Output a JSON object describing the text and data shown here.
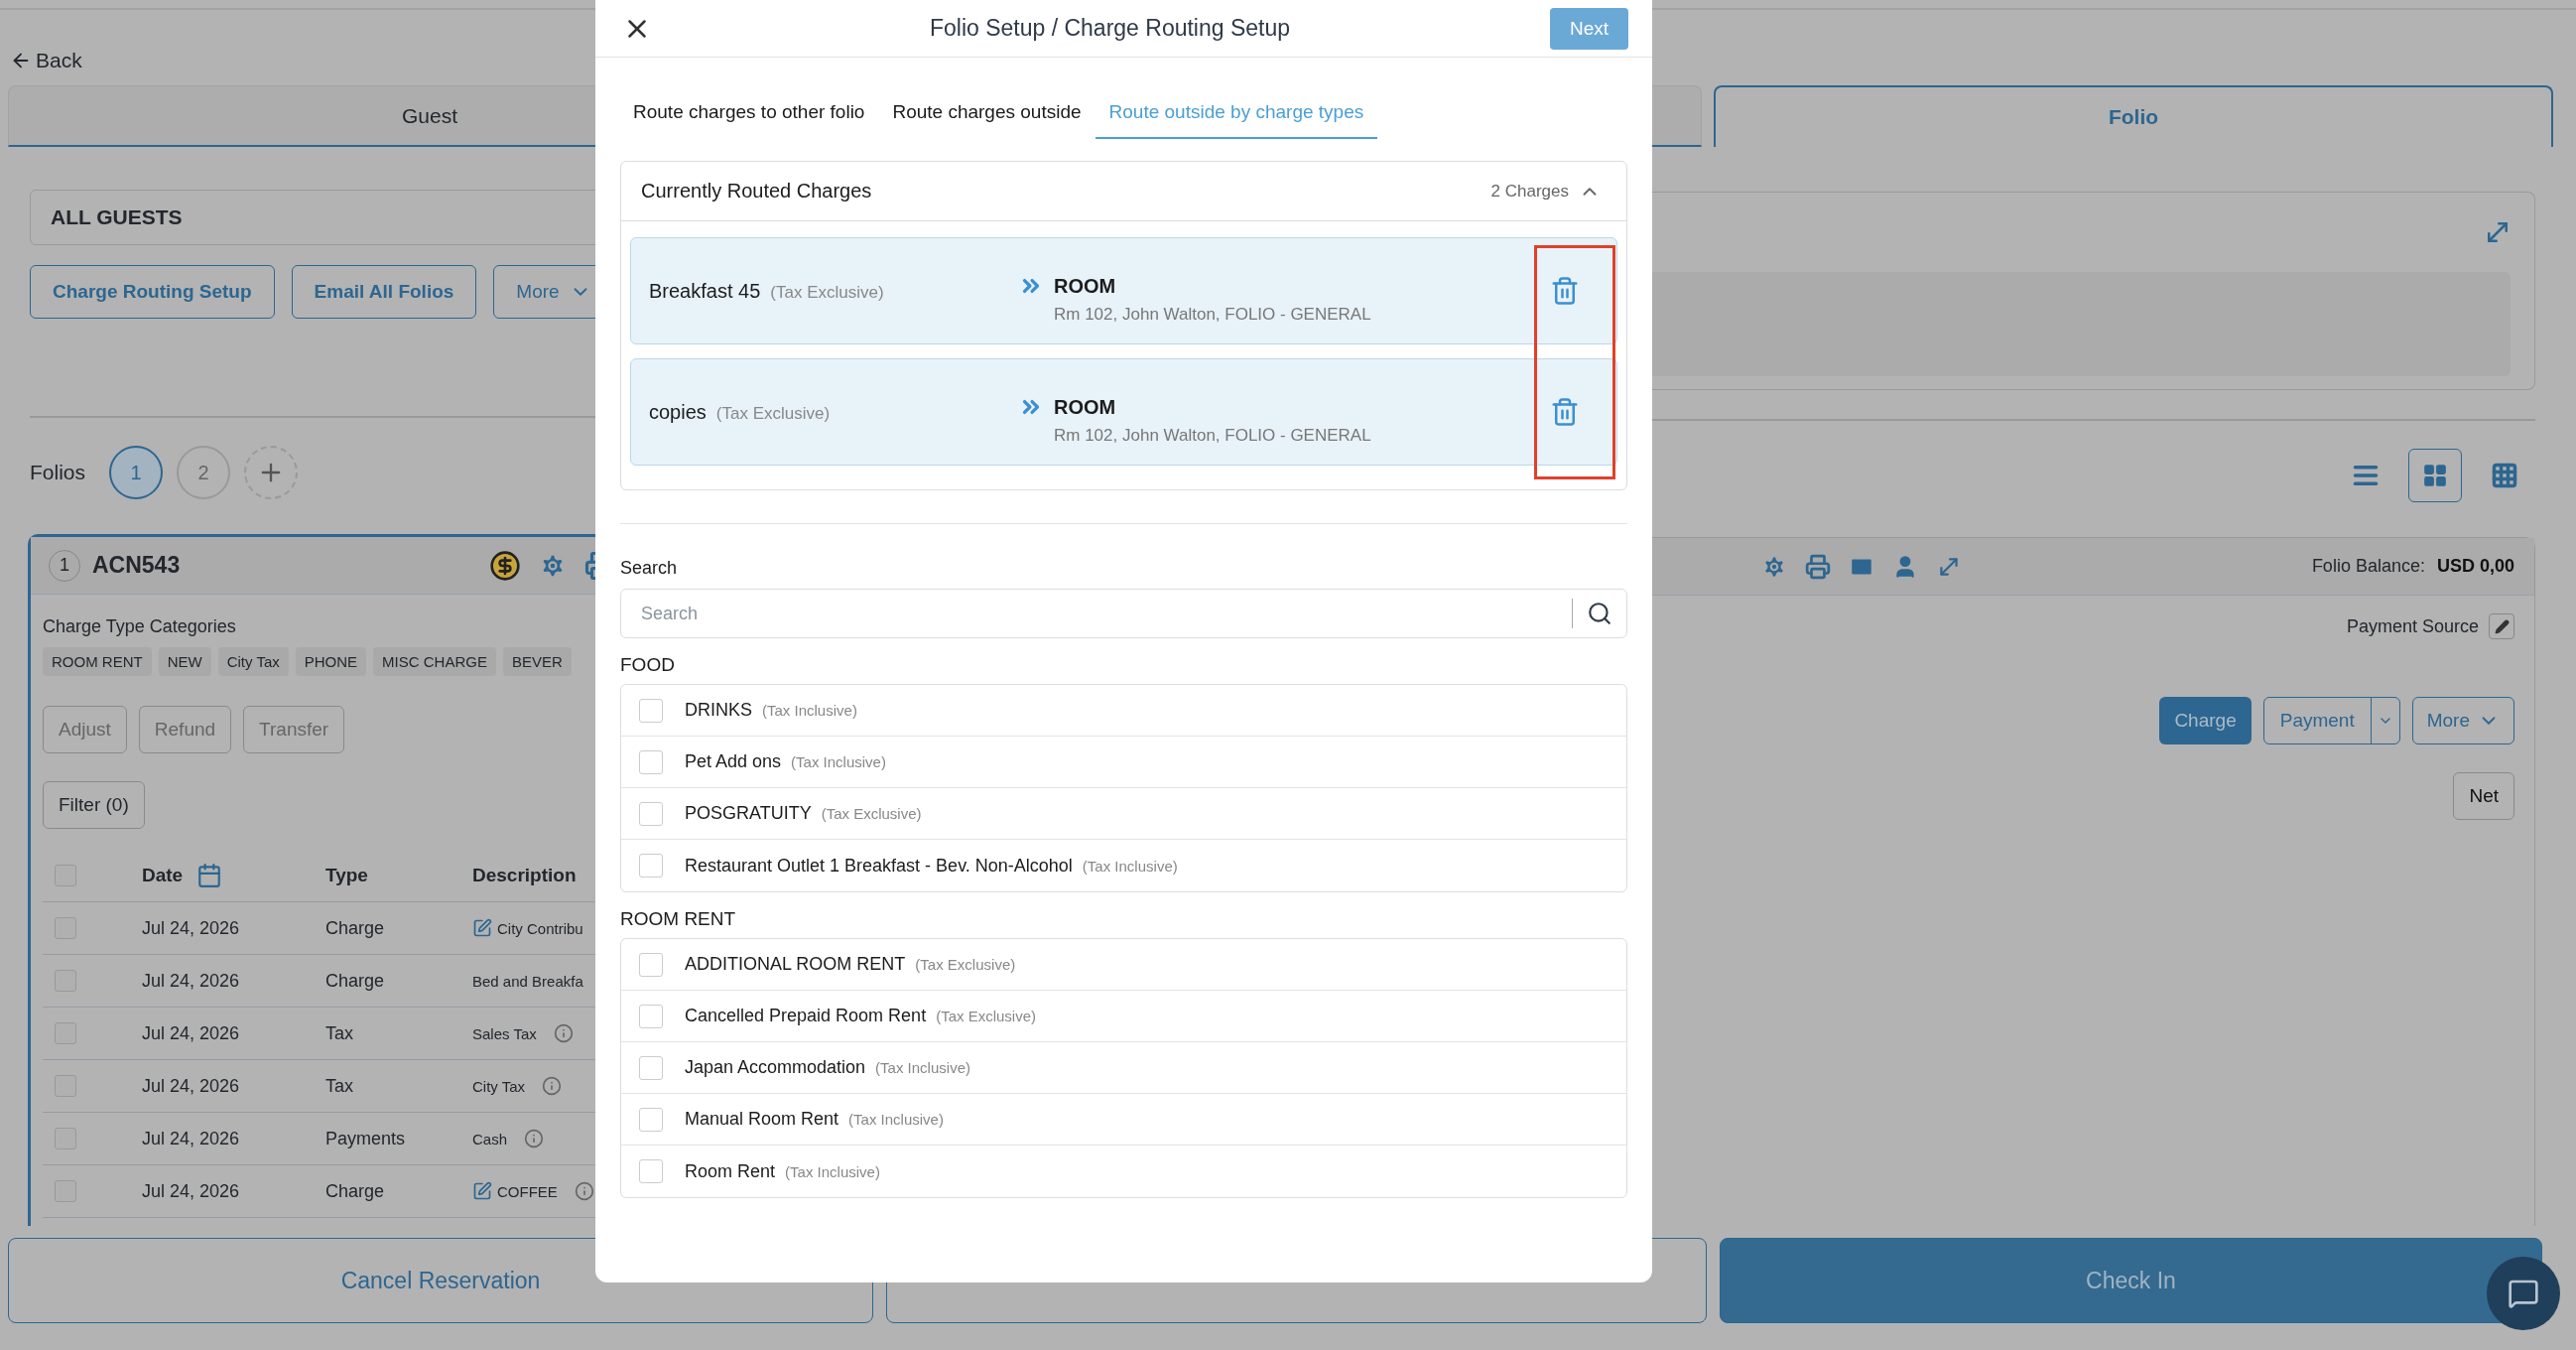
{
  "back": "Back",
  "page_tabs": [
    {
      "label": "Guest",
      "selected": false
    },
    {
      "label": "Folio",
      "selected": true
    }
  ],
  "guests_panel": {
    "title": "ALL GUESTS",
    "buttons": [
      "Charge Routing Setup",
      "Email All Folios"
    ],
    "more": "More"
  },
  "folios": {
    "label": "Folios",
    "items": [
      {
        "label": "1",
        "selected": true
      },
      {
        "label": "2",
        "selected": false
      }
    ]
  },
  "view_modes": [
    {
      "kind": "list",
      "selected": false
    },
    {
      "kind": "grid",
      "selected": true
    },
    {
      "kind": "tiles",
      "selected": false
    }
  ],
  "folio_card": {
    "number": "1",
    "name": "ACN543",
    "balance_label": "Folio Balance:",
    "balance": "USD 0,00",
    "categories_label": "Charge Type Categories",
    "categories": [
      "ROOM RENT",
      "NEW",
      "City Tax",
      "PHONE",
      "MISC CHARGE",
      "BEVER"
    ],
    "payment_source": "Payment Source",
    "left_actions": [
      "Adjust",
      "Refund",
      "Transfer"
    ],
    "charge": "Charge",
    "payment": "Payment",
    "more": "More",
    "filter": "Filter (0)",
    "net": "Net",
    "select_all": {
      "checked": false
    },
    "columns": [
      "Date",
      "Type",
      "Description"
    ],
    "rows": [
      {
        "checked": false,
        "date": "Jul 24, 2026",
        "type": "Charge",
        "description": "City Contribu",
        "edit_icon": true,
        "info_icon": false
      },
      {
        "checked": false,
        "date": "Jul 24, 2026",
        "type": "Charge",
        "description": "Bed and Breakfa",
        "edit_icon": false,
        "info_icon": false
      },
      {
        "checked": false,
        "date": "Jul 24, 2026",
        "type": "Tax",
        "description": "Sales Tax",
        "edit_icon": false,
        "info_icon": true
      },
      {
        "checked": false,
        "date": "Jul 24, 2026",
        "type": "Tax",
        "description": "City Tax",
        "edit_icon": false,
        "info_icon": true
      },
      {
        "checked": false,
        "date": "Jul 24, 2026",
        "type": "Payments",
        "description": "Cash",
        "edit_icon": false,
        "info_icon": true
      },
      {
        "checked": false,
        "date": "Jul 24, 2026",
        "type": "Charge",
        "description": "COFFEE",
        "edit_icon": true,
        "info_icon": true
      }
    ]
  },
  "footer": {
    "cancel": "Cancel Reservation",
    "check_in": "Check In"
  },
  "modal": {
    "title": "Folio Setup / Charge Routing Setup",
    "next": "Next",
    "tabs": [
      {
        "label": "Route charges to other folio",
        "selected": false
      },
      {
        "label": "Route charges outside",
        "selected": false
      },
      {
        "label": "Route outside by charge types",
        "selected": true
      }
    ],
    "routed": {
      "title": "Currently Routed Charges",
      "count": "2 Charges",
      "expanded": true,
      "items": [
        {
          "name": "Breakfast 45",
          "tax": "(Tax Exclusive)",
          "target": "ROOM",
          "detail": "Rm 102, John Walton, FOLIO - GENERAL"
        },
        {
          "name": "copies",
          "tax": "(Tax Exclusive)",
          "target": "ROOM",
          "detail": "Rm 102, John Walton, FOLIO - GENERAL"
        }
      ]
    },
    "search": {
      "label": "Search",
      "placeholder": "Search"
    },
    "groups": [
      {
        "title": "FOOD",
        "items": [
          {
            "name": "DRINKS",
            "tax": "(Tax Inclusive)",
            "checked": false
          },
          {
            "name": "Pet Add ons",
            "tax": "(Tax Inclusive)",
            "checked": false
          },
          {
            "name": "POSGRATUITY",
            "tax": "(Tax Exclusive)",
            "checked": false
          },
          {
            "name": "Restaurant Outlet 1 Breakfast - Bev. Non-Alcohol",
            "tax": "(Tax Inclusive)",
            "checked": false
          }
        ]
      },
      {
        "title": "ROOM RENT",
        "items": [
          {
            "name": "ADDITIONAL ROOM RENT",
            "tax": "(Tax Exclusive)",
            "checked": false
          },
          {
            "name": "Cancelled Prepaid Room Rent",
            "tax": "(Tax Exclusive)",
            "checked": false
          },
          {
            "name": "Japan Accommodation",
            "tax": "(Tax Inclusive)",
            "checked": false
          },
          {
            "name": "Manual Room Rent",
            "tax": "(Tax Inclusive)",
            "checked": false
          },
          {
            "name": "Room Rent",
            "tax": "(Tax Inclusive)",
            "checked": false
          }
        ]
      }
    ]
  }
}
